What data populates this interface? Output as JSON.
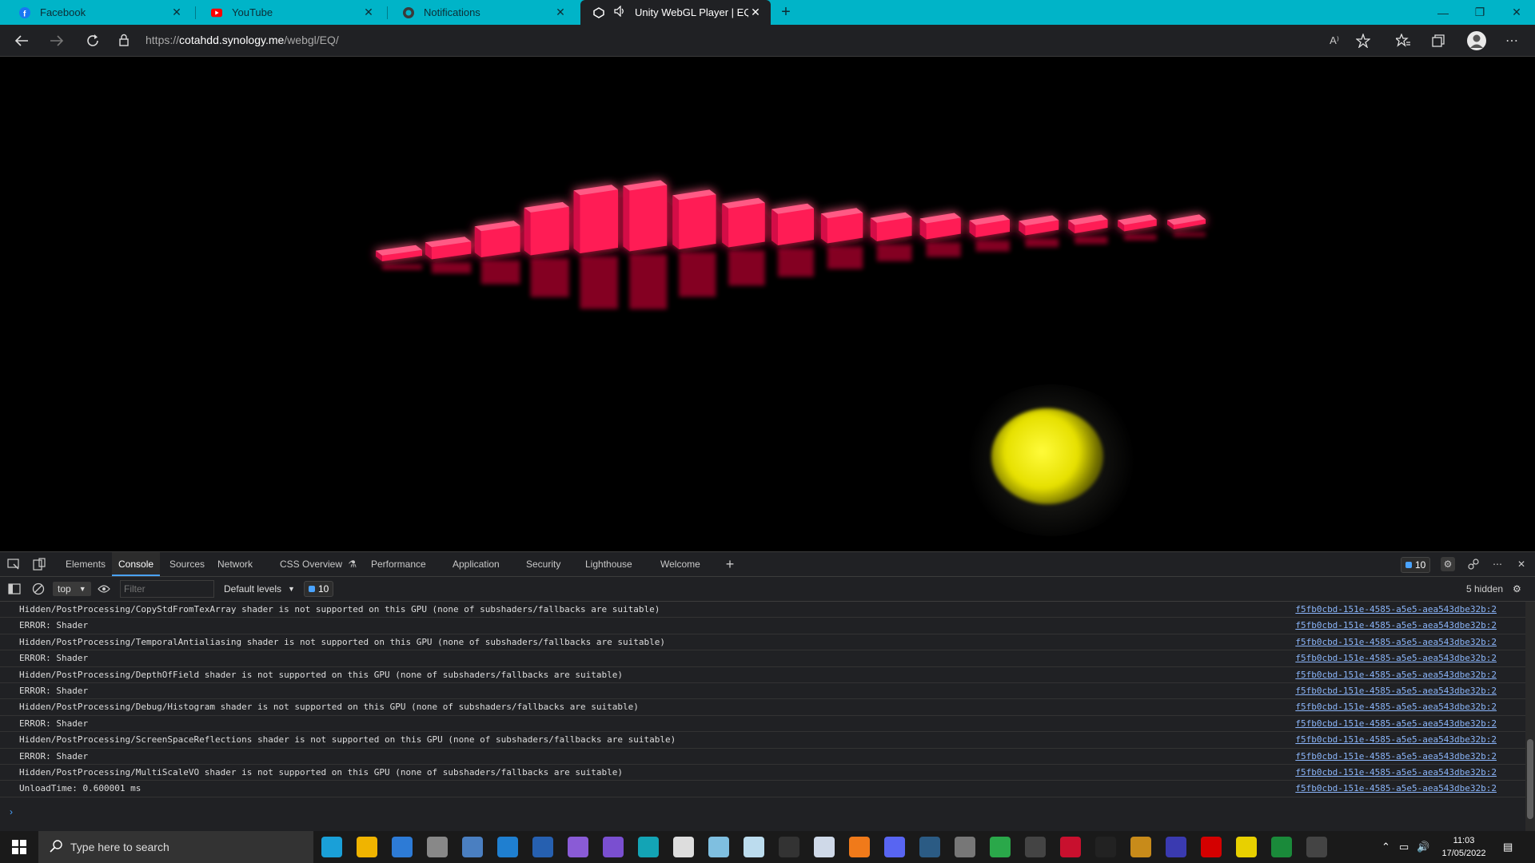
{
  "browser": {
    "tabs": [
      {
        "label": "Facebook",
        "icon": "facebook-icon"
      },
      {
        "label": "YouTube",
        "icon": "youtube-icon"
      },
      {
        "label": "Notifications",
        "icon": "github-icon"
      },
      {
        "label": "Unity WebGL Player | EQ",
        "icon": "unity-icon",
        "active": true
      }
    ],
    "url_prefix": "https://",
    "url_host": "cotahdd.synology.me",
    "url_path": "/webgl/EQ/",
    "read_aloud_label": "A⁾"
  },
  "game": {
    "bar_heights": [
      0.04,
      0.14,
      0.36,
      0.62,
      0.86,
      0.9,
      0.72,
      0.56,
      0.44,
      0.34,
      0.24,
      0.2,
      0.14,
      0.1,
      0.08,
      0.05,
      0.02
    ],
    "bar_color": "#ff1a55",
    "sun_color": "#f4f000"
  },
  "devtools": {
    "tabs": [
      "Elements",
      "Console",
      "Sources",
      "Network",
      "CSS Overview",
      "Performance",
      "Application",
      "Security",
      "Lighthouse",
      "Welcome"
    ],
    "active_tab": "Console",
    "issues_count": "10",
    "context": "top",
    "filter_placeholder": "Filter",
    "levels": "Default levels",
    "levels_count": "10",
    "hidden": "5 hidden",
    "source": "f5fb0cbd-151e-4585-a5e5-aea543dbe32b:2",
    "messages": [
      "Hidden/PostProcessing/CopyStdFromTexArray shader is not supported on this GPU (none of subshaders/fallbacks are suitable)",
      "ERROR: Shader",
      "Hidden/PostProcessing/TemporalAntialiasing shader is not supported on this GPU (none of subshaders/fallbacks are suitable)",
      "ERROR: Shader",
      "Hidden/PostProcessing/DepthOfField shader is not supported on this GPU (none of subshaders/fallbacks are suitable)",
      "ERROR: Shader",
      "Hidden/PostProcessing/Debug/Histogram shader is not supported on this GPU (none of subshaders/fallbacks are suitable)",
      "ERROR: Shader",
      "Hidden/PostProcessing/ScreenSpaceReflections shader is not supported on this GPU (none of subshaders/fallbacks are suitable)",
      "ERROR: Shader",
      "Hidden/PostProcessing/MultiScaleVO shader is not supported on this GPU (none of subshaders/fallbacks are suitable)",
      "UnloadTime: 0.600001 ms"
    ]
  },
  "taskbar": {
    "search_placeholder": "Type here to search",
    "time": "11:03",
    "date": "17/05/2022"
  }
}
